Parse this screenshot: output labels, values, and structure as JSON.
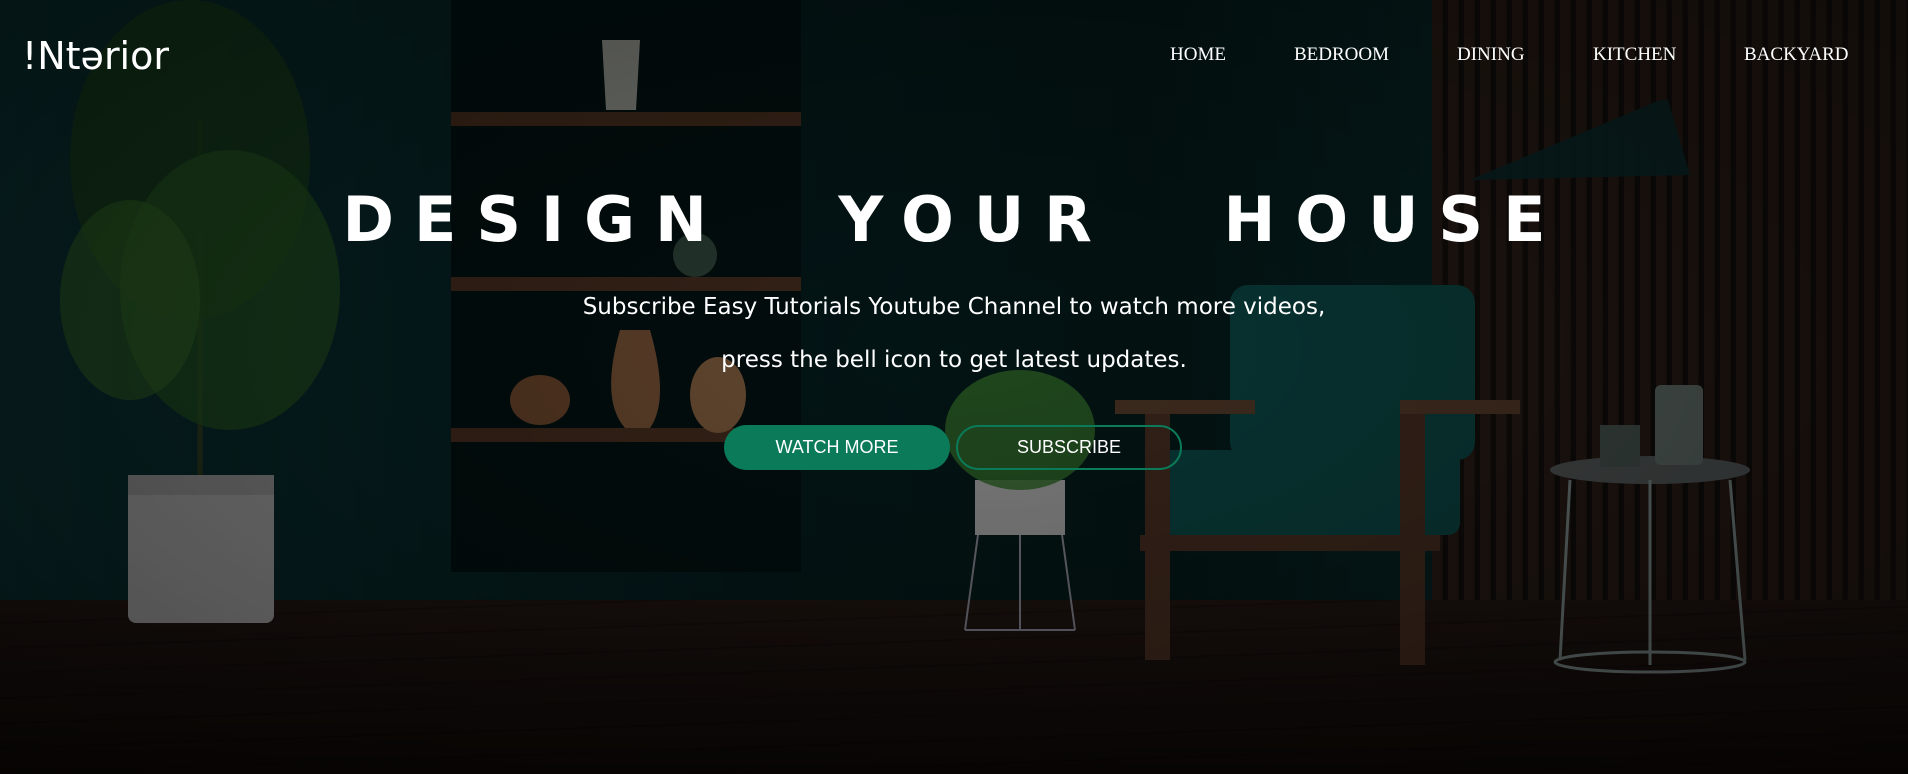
{
  "brand": {
    "logo_text": "!Ntərior"
  },
  "nav": {
    "items": [
      {
        "label": "HOME"
      },
      {
        "label": "BEDROOM"
      },
      {
        "label": "DINING"
      },
      {
        "label": "KITCHEN"
      },
      {
        "label": "BACKYARD"
      }
    ]
  },
  "hero": {
    "title": "DESIGN YOUR HOUSE",
    "subtitle_line1": "Subscribe Easy Tutorials Youtube Channel to watch more videos,",
    "subtitle_line2": "press the bell icon to get latest updates.",
    "primary_button": "WATCH MORE",
    "secondary_button": "SUBSCRIBE"
  },
  "colors": {
    "accent": "#0a7a58",
    "text": "#ffffff",
    "wall": "#0b3234",
    "floor": "#1e1410"
  }
}
